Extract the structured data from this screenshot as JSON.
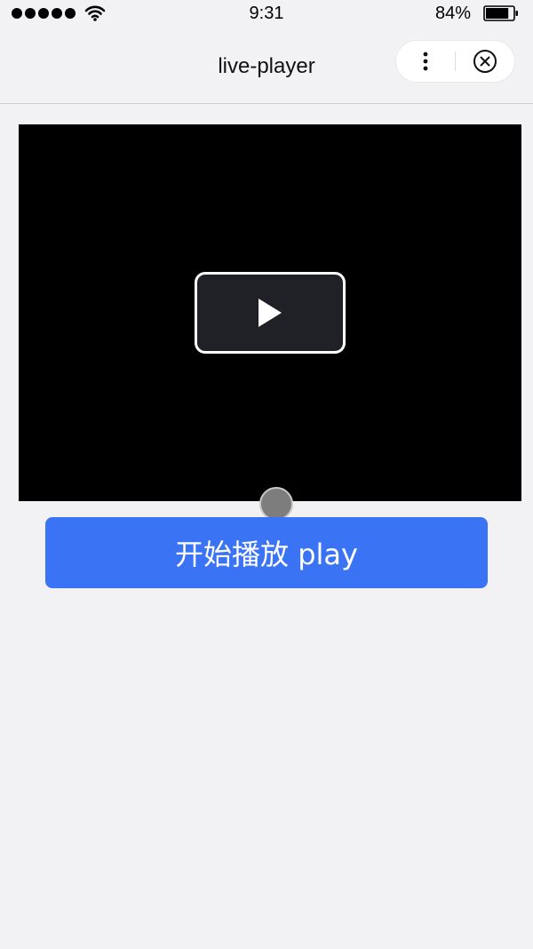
{
  "status_bar": {
    "time": "9:31",
    "battery_percent": "84%",
    "battery_level": 0.84,
    "signal_bars": 5,
    "icons": [
      "signal-dots-icon",
      "wifi-icon",
      "battery-icon"
    ]
  },
  "nav": {
    "title": "live-player",
    "menu_icon": "more-vertical-icon",
    "close_icon": "close-circle-icon"
  },
  "player": {
    "play_icon": "play-icon"
  },
  "actions": {
    "play_label": "开始播放 play"
  },
  "colors": {
    "page_bg": "#f2f2f5",
    "player_bg": "#000000",
    "button_bg": "#3b73f5",
    "button_text": "#ffffff",
    "overlay_bg": "#1f2127"
  }
}
